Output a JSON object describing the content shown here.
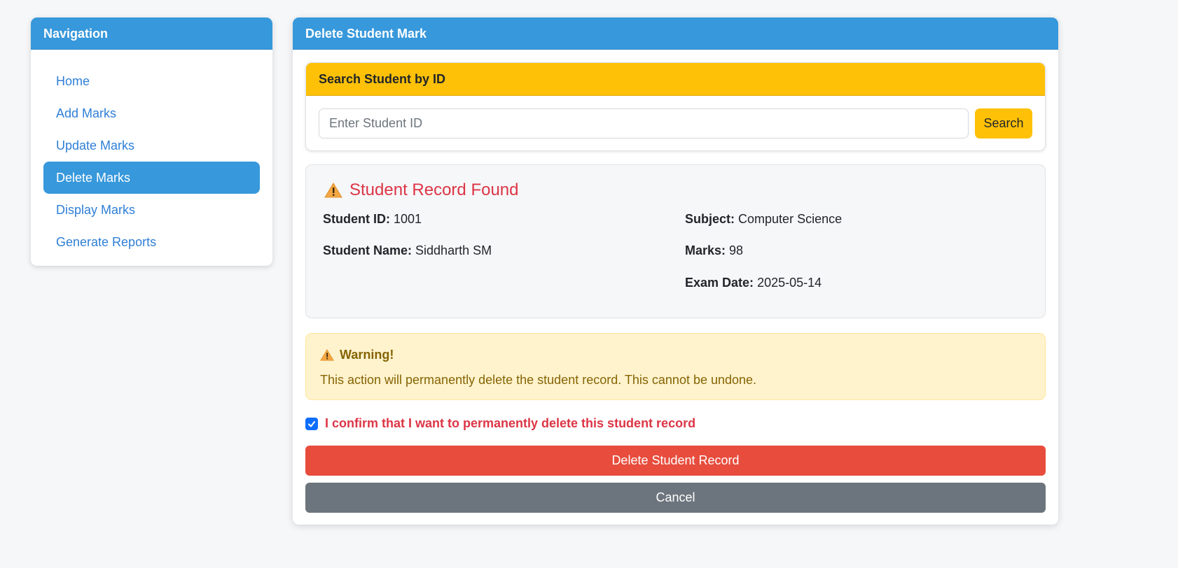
{
  "navigation": {
    "title": "Navigation",
    "items": [
      {
        "label": "Home"
      },
      {
        "label": "Add Marks"
      },
      {
        "label": "Update Marks"
      },
      {
        "label": "Delete Marks",
        "active": true
      },
      {
        "label": "Display Marks"
      },
      {
        "label": "Generate Reports"
      }
    ]
  },
  "main": {
    "title": "Delete Student Mark",
    "search": {
      "title": "Search Student by ID",
      "placeholder": "Enter Student ID",
      "value": "",
      "button_label": "Search"
    },
    "record": {
      "title": "Student Record Found",
      "icon": "warning-icon",
      "student_id_label": "Student ID:",
      "student_id": "1001",
      "student_name_label": "Student Name:",
      "student_name": "Siddharth SM",
      "subject_label": "Subject:",
      "subject": "Computer Science",
      "marks_label": "Marks:",
      "marks": "98",
      "exam_date_label": "Exam Date:",
      "exam_date": "2025-05-14"
    },
    "warning": {
      "title": "Warning!",
      "text": "This action will permanently delete the student record. This cannot be undone."
    },
    "confirm": {
      "label": "I confirm that I want to permanently delete this student record",
      "checked": true
    },
    "delete_button": "Delete Student Record",
    "cancel_button": "Cancel"
  },
  "colors": {
    "primary": "#3798db",
    "warning": "#ffc107",
    "danger": "#e74c3c",
    "secondary": "#6c757d",
    "danger_text": "#dc3545"
  }
}
